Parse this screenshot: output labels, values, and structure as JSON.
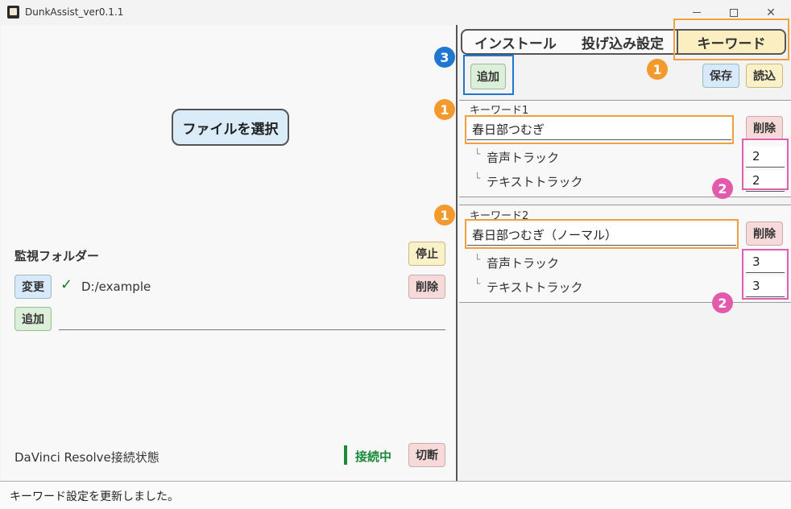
{
  "window": {
    "title": "DunkAssist_ver0.1.1",
    "minimize_icon": "minimize-icon",
    "maximize_icon": "maximize-icon",
    "close_icon": "close-icon",
    "close_glyph": "✕"
  },
  "left": {
    "file_select_label": "ファイルを選択",
    "watch_folder_label": "監視フォルダー",
    "stop_label": "停止",
    "change_label": "変更",
    "check_glyph": "✓",
    "folder_path": "D:/example",
    "delete_label": "削除",
    "add_label": "追加",
    "davinci_status_label": "DaVinci Resolve接続状態",
    "connected_label": "接続中",
    "disconnect_label": "切断"
  },
  "tabs": [
    {
      "label": "インストール"
    },
    {
      "label": "投げ込み設定"
    },
    {
      "label": "キーワード"
    }
  ],
  "keyword_toolbar": {
    "add_label": "追加",
    "save_label": "保存",
    "load_label": "読込"
  },
  "keywords": [
    {
      "title": "キーワード1",
      "value": "春日部つむぎ",
      "delete_label": "削除",
      "branch_glyph": "└",
      "audio_track_label": "音声トラック",
      "audio_track_value": "2",
      "text_track_label": "テキストトラック",
      "text_track_value": "2"
    },
    {
      "title": "キーワード2",
      "value": "春日部つむぎ（ノーマル）",
      "delete_label": "削除",
      "branch_glyph": "└",
      "audio_track_label": "音声トラック",
      "audio_track_value": "3",
      "text_track_label": "テキストトラック",
      "text_track_value": "3"
    }
  ],
  "annotations": {
    "badge1": "1",
    "badge2": "2",
    "badge3": "3"
  },
  "status": {
    "message": "キーワード設定を更新しました。"
  },
  "colors": {
    "accent_orange": "#f39a2e",
    "accent_blue": "#1e78d0",
    "accent_pink": "#e35aac",
    "connected_green": "#1a8a3a"
  }
}
